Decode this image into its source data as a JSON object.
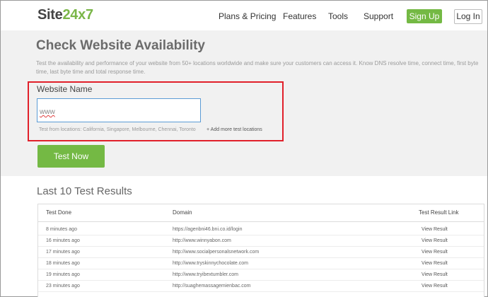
{
  "header": {
    "logo_prefix": "Site",
    "logo_suffix": "24x7",
    "nav": [
      "Plans & Pricing",
      "Features",
      "Tools",
      "Support"
    ],
    "signup_label": "Sign Up",
    "login_label": "Log In",
    "brand_color": "#74b944"
  },
  "hero": {
    "title": "Check Website Availability",
    "description": "Test the availability and performance of your website from 50+ locations worldwide and make sure your customers can access it. Know DNS resolve time, connect time, first byte time, last byte time and total response time.",
    "field_label": "Website Name",
    "input_value": "www",
    "locations_text": "Test from locations: California, Singapore, Melbourne, Chennai, Toronto",
    "add_more_label": "+ Add more test locations",
    "test_button_label": "Test Now",
    "highlight_color": "#e1202a"
  },
  "results": {
    "title": "Last 10 Test Results",
    "columns": [
      "Test Done",
      "Domain",
      "Test Result Link"
    ],
    "rows": [
      {
        "time": "8 minutes ago",
        "domain": "https://agenbni46.bni.co.id/login",
        "link": "View Result"
      },
      {
        "time": "16 minutes ago",
        "domain": "http://www.winnyabon.com",
        "link": "View Result"
      },
      {
        "time": "17 minutes ago",
        "domain": "http://www.socialpersonalsnetwork.com",
        "link": "View Result"
      },
      {
        "time": "18 minutes ago",
        "domain": "http://www.tryskinnychocolate.com",
        "link": "View Result"
      },
      {
        "time": "19 minutes ago",
        "domain": "http://www.tryibextumbler.com",
        "link": "View Result"
      },
      {
        "time": "23 minutes ago",
        "domain": "http://suaghemassagemienbac.com",
        "link": "View Result"
      }
    ]
  }
}
